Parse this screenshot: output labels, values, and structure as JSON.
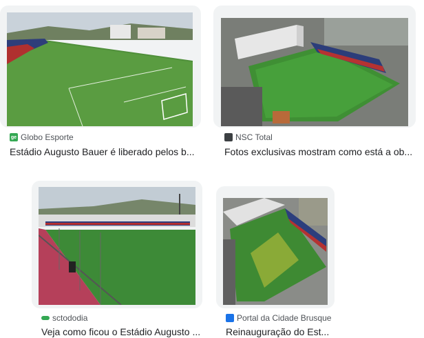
{
  "results": [
    {
      "source": "Globo Esporte",
      "source_icon": "globo-esporte-favicon",
      "favicon_color": "#34a853",
      "favicon_text": "ge",
      "title": "Estádio Augusto Bauer é liberado pelos b..."
    },
    {
      "source": "NSC Total",
      "source_icon": "nsc-total-favicon",
      "favicon_color": "#3c4043",
      "favicon_text": "",
      "title": "Fotos exclusivas mostram como está a ob..."
    },
    {
      "source": "sctododia",
      "source_icon": "sctododia-favicon",
      "favicon_color": "#34a853",
      "favicon_text": "",
      "title": "Veja como ficou o Estádio Augusto ..."
    },
    {
      "source": "Portal da Cidade Brusque",
      "source_icon": "portal-da-cidade-favicon",
      "favicon_color": "#1a73e8",
      "favicon_text": "",
      "title": "Reinauguração do Est..."
    }
  ]
}
